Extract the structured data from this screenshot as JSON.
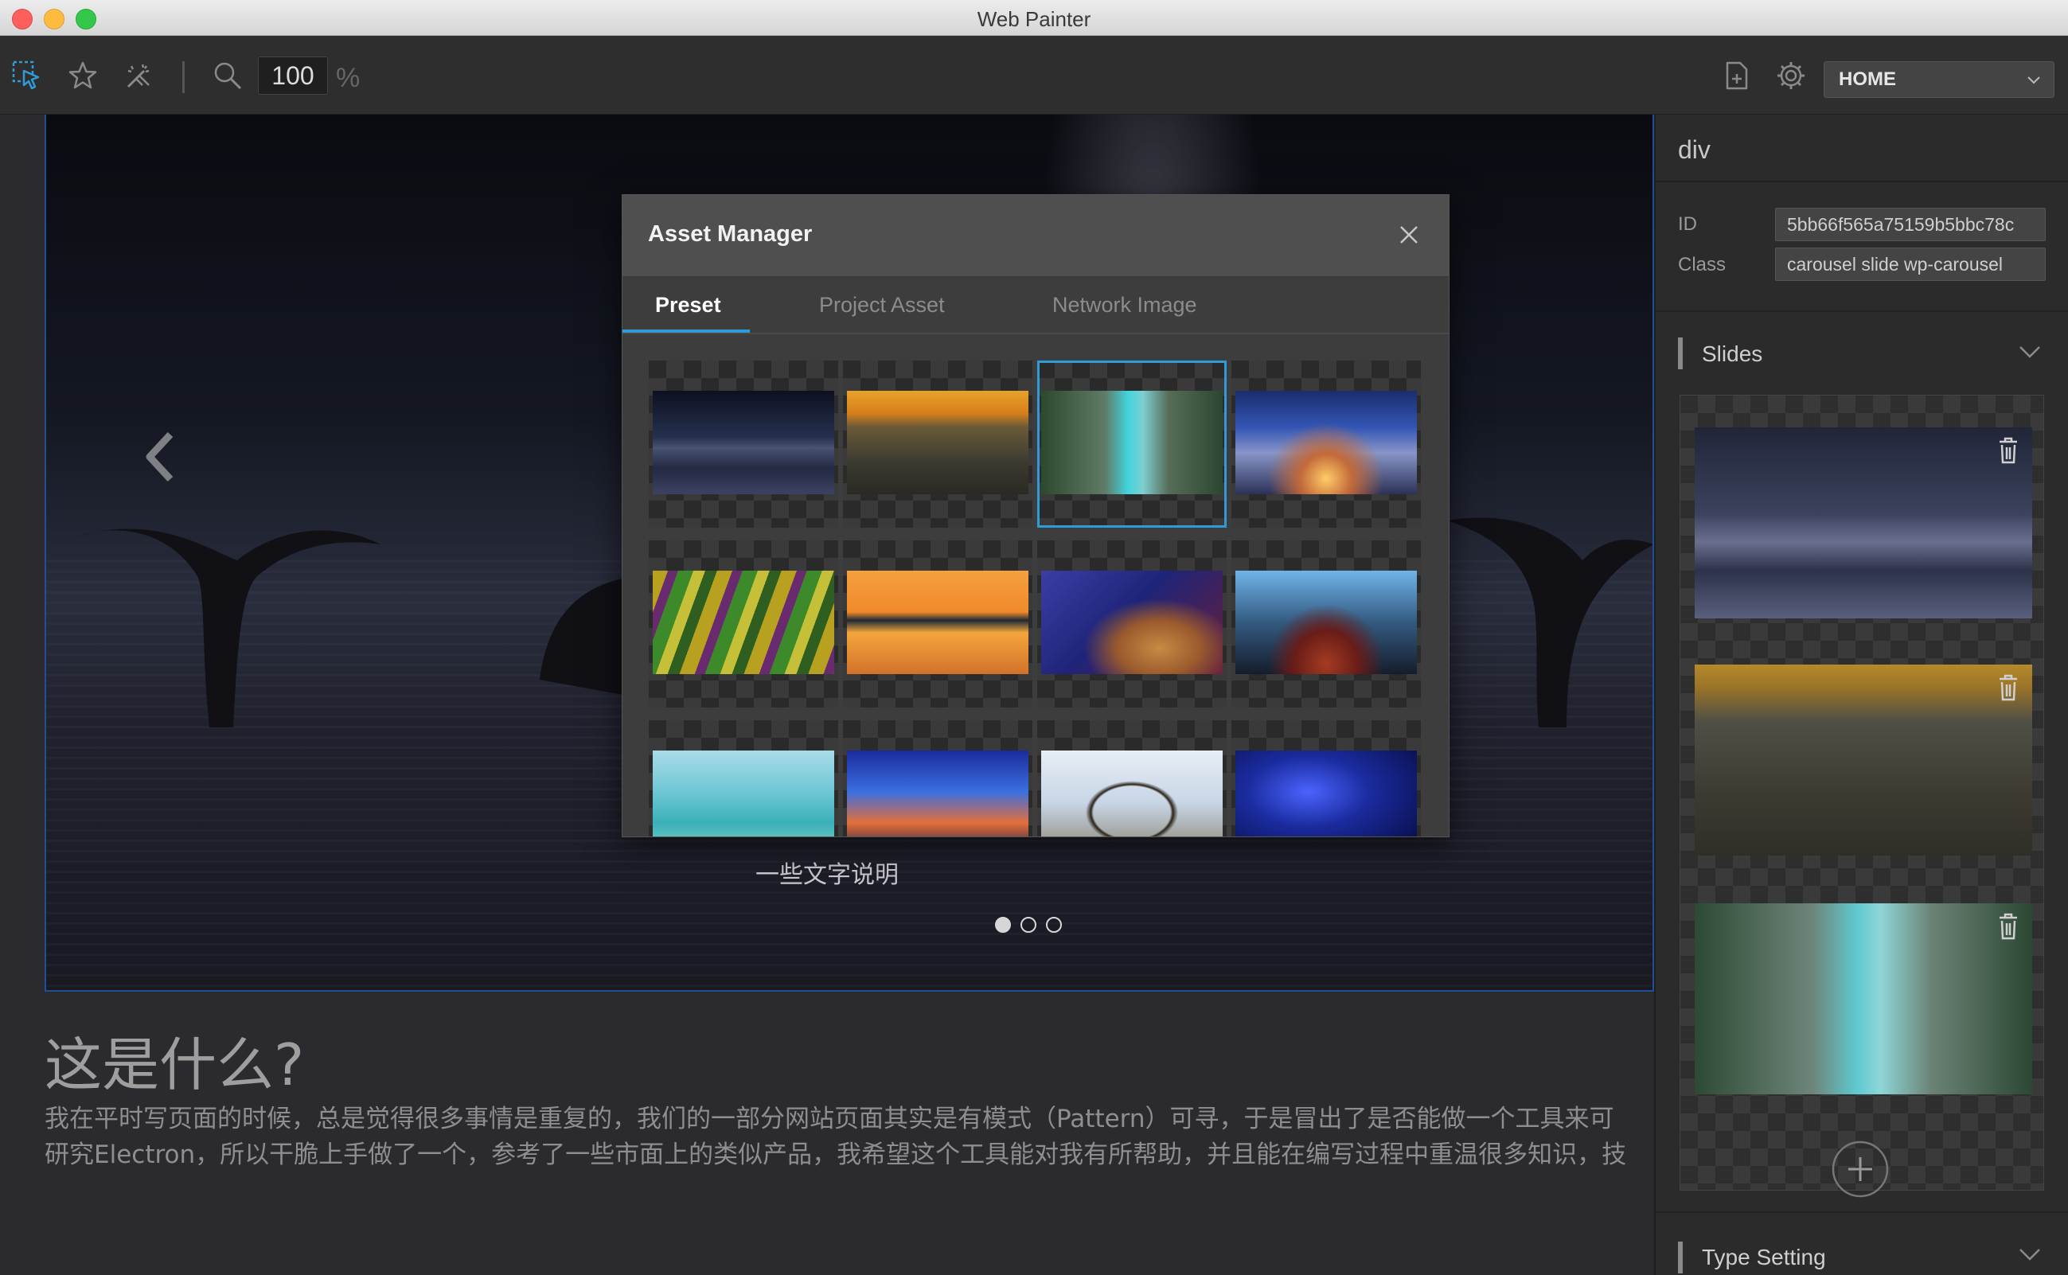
{
  "window": {
    "title": "Web Painter"
  },
  "toolbar": {
    "zoom_value": "100",
    "zoom_unit": "%",
    "page_selected": "HOME",
    "icons": [
      "select-cursor-icon",
      "star-icon",
      "magic-wand-icon",
      "search-icon",
      "new-page-icon",
      "gear-icon"
    ]
  },
  "canvas": {
    "caption": "一些文字说明",
    "article_title": "这是什么?",
    "article_body": [
      "我在平时写页面的时候，总是觉得很多事情是重复的，我们的一部分网站页面其实是有模式（Pattern）可寻，于是冒出了是否能做一个工具来可",
      "研究Electron，所以干脆上手做了一个，参考了一些市面上的类似产品，我希望这个工具能对我有所帮助，并且能在编写过程中重温很多知识，技"
    ],
    "carousel_dots": 3,
    "active_dot": 0
  },
  "modal": {
    "title": "Asset Manager",
    "tabs": [
      "Preset",
      "Project Asset",
      "Network Image"
    ],
    "active_tab": "Preset",
    "selected_index": 2,
    "assets": [
      "whales",
      "cliff",
      "river",
      "city-night",
      "flower-fields",
      "sunset-fisher",
      "desert-rock",
      "ship-bow",
      "tropical-beach",
      "blue-city",
      "roller-coaster",
      "blue-night"
    ]
  },
  "inspector": {
    "element_tag": "div",
    "id_label": "ID",
    "id_value": "5bb66f565a75159b5bbc78c",
    "class_label": "Class",
    "class_value": "carousel slide wp-carousel",
    "slides_title": "Slides",
    "type_setting_title": "Type Setting",
    "slides": [
      "whales",
      "cliff",
      "river"
    ]
  },
  "colors": {
    "accent": "#2f9bd9",
    "selection_outline": "#2e6ed0",
    "panel_bg": "#2b2b2b"
  }
}
